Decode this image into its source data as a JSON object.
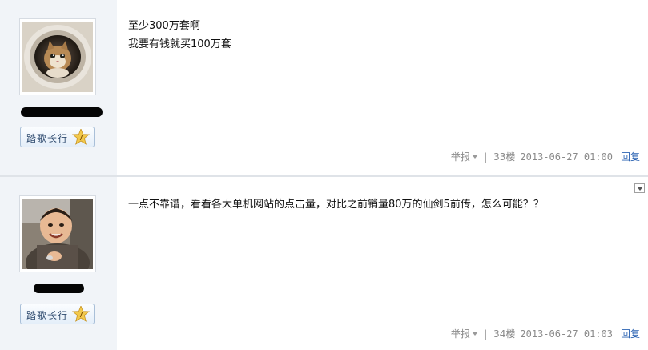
{
  "posts": [
    {
      "author": {
        "avatar": "cat-in-tube-photo",
        "username_visible": false
      },
      "badge": {
        "label": "踏歌长行",
        "level": "7"
      },
      "content": [
        "至少300万套啊",
        "我要有钱就买100万套"
      ],
      "meta": {
        "report": "举报",
        "floor": "33楼",
        "date": "2013-06-27 01:00",
        "reply": "回复"
      }
    },
    {
      "author": {
        "avatar": "child-photo",
        "username_visible": false
      },
      "badge": {
        "label": "踏歌长行",
        "level": "7"
      },
      "content": [
        "一点不靠谱，看看各大单机网站的点击量，对比之前销量80万的仙剑5前传，怎么可能？？"
      ],
      "meta": {
        "report": "举报",
        "floor": "34楼",
        "date": "2013-06-27 01:03",
        "reply": "回复"
      }
    }
  ],
  "colors": {
    "sidebar": "#f1f4f8",
    "link": "#2d64b3",
    "meta": "#8a8a8a",
    "badge_border": "#a9bfd8"
  }
}
